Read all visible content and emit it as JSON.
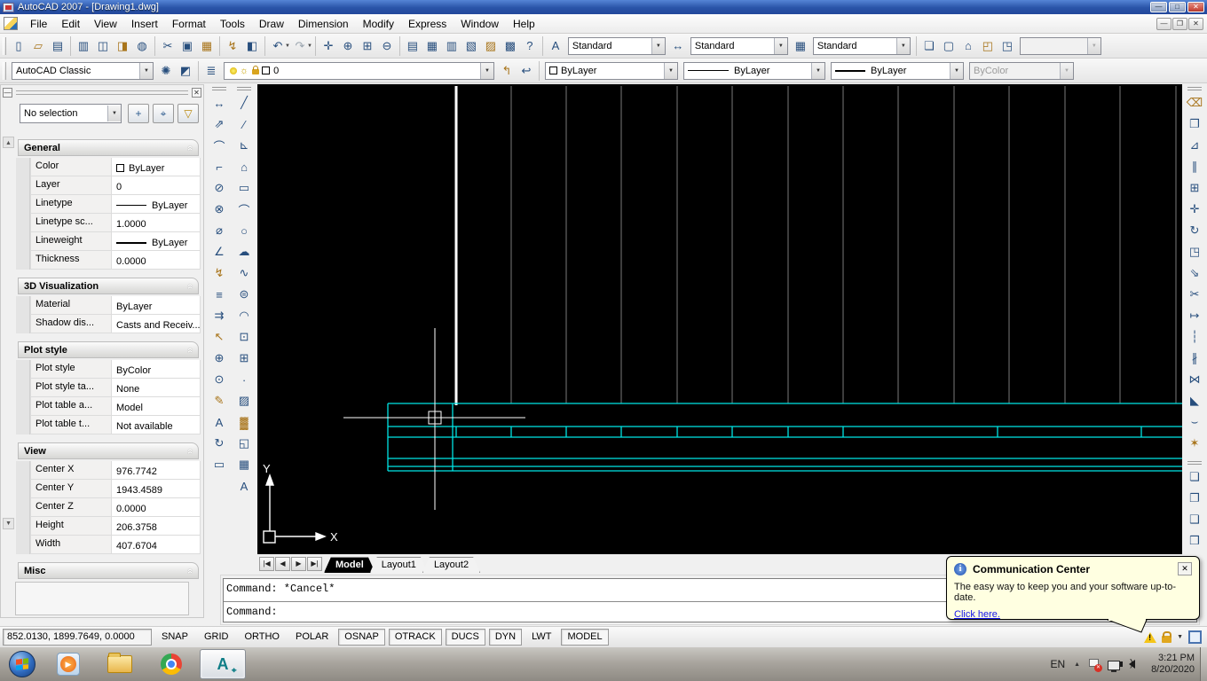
{
  "titlebar": {
    "title": "AutoCAD 2007 - [Drawing1.dwg]"
  },
  "menubar": {
    "items": [
      "File",
      "Edit",
      "View",
      "Insert",
      "Format",
      "Tools",
      "Draw",
      "Dimension",
      "Modify",
      "Express",
      "Window",
      "Help"
    ]
  },
  "icons": {
    "min": "—",
    "max": "□",
    "closex": "✕",
    "restore": "❐",
    "arrow": "▼",
    "chev": "«",
    "up": "▲",
    "new": "▯",
    "open": "▱",
    "save": "▤",
    "plot": "▥",
    "preview": "◫",
    "publish": "◨",
    "dwf": "◍",
    "cut": "✂",
    "copy": "▣",
    "paste": "▦",
    "match": "↯",
    "blockedit": "◧",
    "undo": "↶",
    "redo": "↷",
    "pan": "✛",
    "zoomrt": "⊕",
    "zoomwin": "⊞",
    "zoomprev": "⊖",
    "props": "▤",
    "dcenter": "▦",
    "tpal": "▥",
    "sheetset": "▧",
    "markup": "▨",
    "calc": "▩",
    "help": "?",
    "textstyle": "A",
    "dimstyle": "↔",
    "tablestyle": "▦",
    "vp1": "❏",
    "vp2": "▢",
    "vp3": "⌂",
    "vp4": "◰",
    "vp5": "◳",
    "gear": "✺",
    "myws": "◩",
    "laymgr": "≣",
    "laycur": "↰",
    "layprev": "↩",
    "pickadd": "+",
    "selobj": "⌖",
    "qselect": "▽",
    "sun": "☼",
    "dli": "↔",
    "dal": "⇗",
    "dar": "⌒",
    "dor": "⌐",
    "dra": "⊘",
    "djo": "⊗",
    "ddi": "⌀",
    "dan": "∠",
    "qdim": "↯",
    "dba": "≡",
    "dco": "⇉",
    "dle": "↖",
    "dtol": "⊕",
    "dcen": "⊙",
    "dtedit": "✎",
    "dedit": "A",
    "dupd": "↻",
    "dsty": "▭",
    "line": "╱",
    "xline": "∕",
    "pline": "⊾",
    "pgon": "⌂",
    "rect": "▭",
    "arc": "⌒",
    "circ": "○",
    "cloud": "☁",
    "spl": "∿",
    "ell": "⊜",
    "ellarc": "◠",
    "ins": "⊡",
    "blk": "⊞",
    "pt": "∙",
    "hatch": "▨",
    "grad": "▓",
    "region": "◱",
    "table": "▦",
    "mtext": "A",
    "erase": "⌫",
    "copy2": "❐",
    "mirror": "⊿",
    "offset": "∥",
    "array": "⊞",
    "move": "✛",
    "rotate": "↻",
    "scale": "◳",
    "stretch": "⇘",
    "trim": "✂",
    "extend": "↦",
    "brkpt": "┆",
    "brk": "∦",
    "join": "⋈",
    "cham": "◣",
    "fillet": "⌣",
    "expl": "✶",
    "do1": "❏",
    "do2": "❐",
    "do3": "❑",
    "do4": "❒",
    "tabfirst": "|◀",
    "tabprev": "◀",
    "tabnext": "▶",
    "tablast": "▶|",
    "info": "i"
  },
  "styles": {
    "text": "Standard",
    "dimension": "Standard",
    "table": "Standard",
    "viewport_scale": ""
  },
  "workspace": {
    "value": "AutoCAD Classic"
  },
  "layer": {
    "value": "0"
  },
  "object_props": {
    "color": "ByLayer",
    "linetype": "ByLayer",
    "lineweight": "ByLayer",
    "plot_style": "ByColor"
  },
  "palette": {
    "selection": "No selection",
    "general": {
      "title": "General",
      "rows": [
        {
          "label": "Color",
          "value": "ByLayer"
        },
        {
          "label": "Layer",
          "value": "0"
        },
        {
          "label": "Linetype",
          "value": "ByLayer"
        },
        {
          "label": "Linetype sc...",
          "value": "1.0000"
        },
        {
          "label": "Lineweight",
          "value": "ByLayer"
        },
        {
          "label": "Thickness",
          "value": "0.0000"
        }
      ]
    },
    "viz": {
      "title": "3D Visualization",
      "rows": [
        {
          "label": "Material",
          "value": "ByLayer"
        },
        {
          "label": "Shadow dis...",
          "value": "Casts and Receiv..."
        }
      ]
    },
    "plot": {
      "title": "Plot style",
      "rows": [
        {
          "label": "Plot style",
          "value": "ByColor"
        },
        {
          "label": "Plot style ta...",
          "value": "None"
        },
        {
          "label": "Plot table a...",
          "value": "Model"
        },
        {
          "label": "Plot table t...",
          "value": "Not available"
        }
      ]
    },
    "view": {
      "title": "View",
      "rows": [
        {
          "label": "Center X",
          "value": "976.7742"
        },
        {
          "label": "Center Y",
          "value": "1943.4589"
        },
        {
          "label": "Center Z",
          "value": "0.0000"
        },
        {
          "label": "Height",
          "value": "206.3758"
        },
        {
          "label": "Width",
          "value": "407.6704"
        }
      ]
    },
    "misc": {
      "title": "Misc"
    }
  },
  "ucs": {
    "x_label": "X",
    "y_label": "Y"
  },
  "tabs": {
    "model": "Model",
    "layout1": "Layout1",
    "layout2": "Layout2"
  },
  "command": {
    "history": "Command: *Cancel*",
    "prompt": "Command:"
  },
  "statusbar": {
    "coords": "852.0130, 1899.7649, 0.0000",
    "toggles": [
      {
        "label": "SNAP"
      },
      {
        "label": "GRID"
      },
      {
        "label": "ORTHO"
      },
      {
        "label": "POLAR"
      },
      {
        "label": "OSNAP"
      },
      {
        "label": "OTRACK"
      },
      {
        "label": "DUCS"
      },
      {
        "label": "DYN"
      },
      {
        "label": "LWT"
      },
      {
        "label": "MODEL"
      }
    ]
  },
  "balloon": {
    "title": "Communication Center",
    "body": "The easy way to keep you and your software up-to-date.",
    "link": "Click here."
  },
  "taskbar": {
    "language": "EN",
    "time": "3:21 PM",
    "date": "8/20/2020"
  },
  "colors": {
    "cyan": "#00e5e5",
    "balloon_bg": "#ffffe1",
    "canvas": "#000000"
  }
}
